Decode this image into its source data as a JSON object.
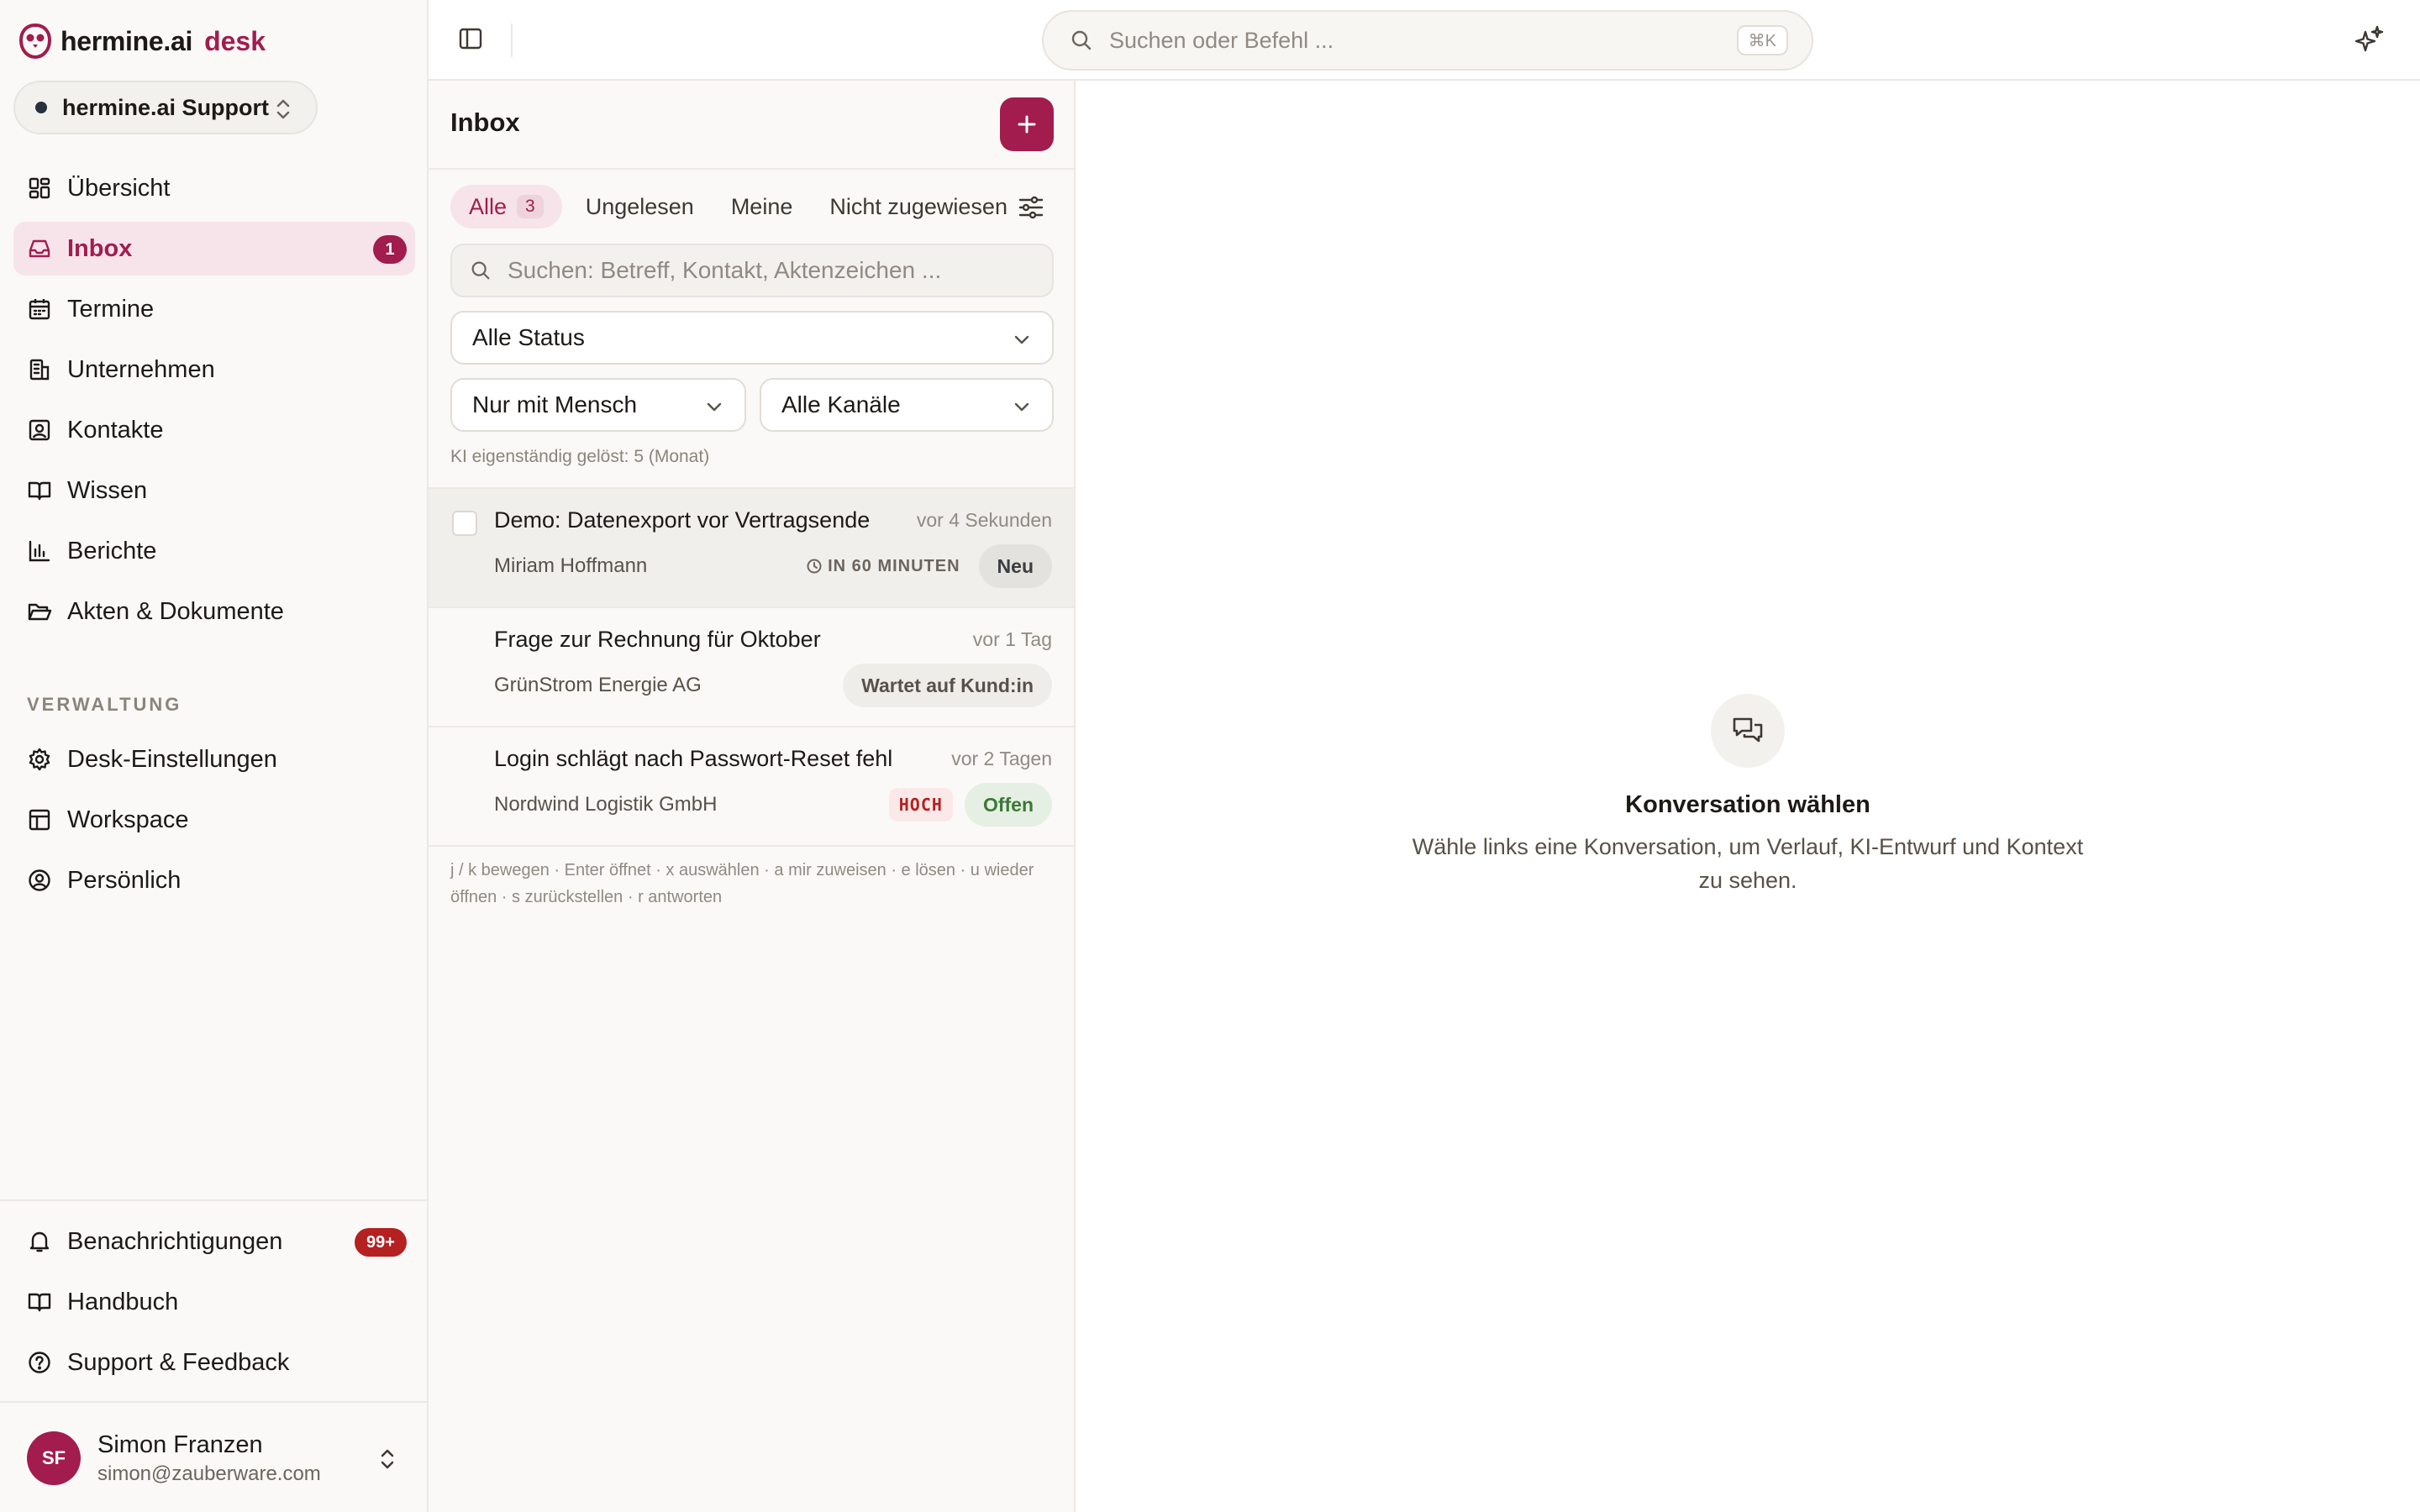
{
  "brand": {
    "name": "hermine.ai",
    "product": "desk"
  },
  "workspace": {
    "name": "hermine.ai Support"
  },
  "sidebar": {
    "nav": [
      {
        "label": "Übersicht",
        "icon": "dashboard-icon"
      },
      {
        "label": "Inbox",
        "icon": "inbox-icon",
        "badge": "1",
        "active": true
      },
      {
        "label": "Termine",
        "icon": "calendar-icon"
      },
      {
        "label": "Unternehmen",
        "icon": "building-icon"
      },
      {
        "label": "Kontakte",
        "icon": "contact-icon"
      },
      {
        "label": "Wissen",
        "icon": "book-icon"
      },
      {
        "label": "Berichte",
        "icon": "bar-chart-icon"
      },
      {
        "label": "Akten & Dokumente",
        "icon": "folder-icon"
      }
    ],
    "section_admin": "VERWALTUNG",
    "admin": [
      {
        "label": "Desk-Einstellungen",
        "icon": "gear-icon"
      },
      {
        "label": "Workspace",
        "icon": "layout-icon"
      },
      {
        "label": "Persönlich",
        "icon": "user-circle-icon"
      }
    ],
    "bottom": [
      {
        "label": "Benachrichtigungen",
        "icon": "bell-icon",
        "badge": "99+"
      },
      {
        "label": "Handbuch",
        "icon": "book-icon"
      },
      {
        "label": "Support & Feedback",
        "icon": "help-circle-icon"
      }
    ],
    "user": {
      "initials": "SF",
      "name": "Simon Franzen",
      "email": "simon@zauberware.com"
    }
  },
  "topbar": {
    "search_placeholder": "Suchen oder Befehl ...",
    "shortcut": "⌘K"
  },
  "inbox": {
    "title": "Inbox",
    "tabs": [
      {
        "label": "Alle",
        "count": "3",
        "active": true
      },
      {
        "label": "Ungelesen"
      },
      {
        "label": "Meine"
      },
      {
        "label": "Nicht zugewiesen"
      }
    ],
    "search_placeholder": "Suchen: Betreff, Kontakt, Aktenzeichen ...",
    "filters": {
      "status": "Alle Status",
      "handler": "Nur mit Mensch",
      "channels": "Alle Kanäle"
    },
    "stat_line": "KI eigenständig gelöst: 5 (Monat)",
    "conversations": [
      {
        "subject": "Demo: Datenexport vor Vertragsende",
        "time": "vor 4 Sekunden",
        "contact": "Miriam Hoffmann",
        "sla": "IN 60 MINUTEN",
        "status": "Neu"
      },
      {
        "subject": "Frage zur Rechnung für Oktober",
        "time": "vor 1 Tag",
        "contact": "GrünStrom Energie AG",
        "status": "Wartet auf Kund:in"
      },
      {
        "subject": "Login schlägt nach Passwort-Reset fehl",
        "time": "vor 2 Tagen",
        "contact": "Nordwind Logistik GmbH",
        "priority": "HOCH",
        "status": "Offen"
      }
    ],
    "shortcuts_hint": "j / k bewegen · Enter öffnet · x auswählen · a mir zuweisen · e lösen · u wieder öffnen · s zurückstellen · r antworten"
  },
  "detail": {
    "empty_title": "Konversation wählen",
    "empty_desc": "Wähle links eine Konversation, um Verlauf, KI-Entwurf und Kontext zu sehen."
  },
  "colors": {
    "accent": "#a31c4e",
    "danger": "#b52020",
    "success": "#3a7a35"
  }
}
